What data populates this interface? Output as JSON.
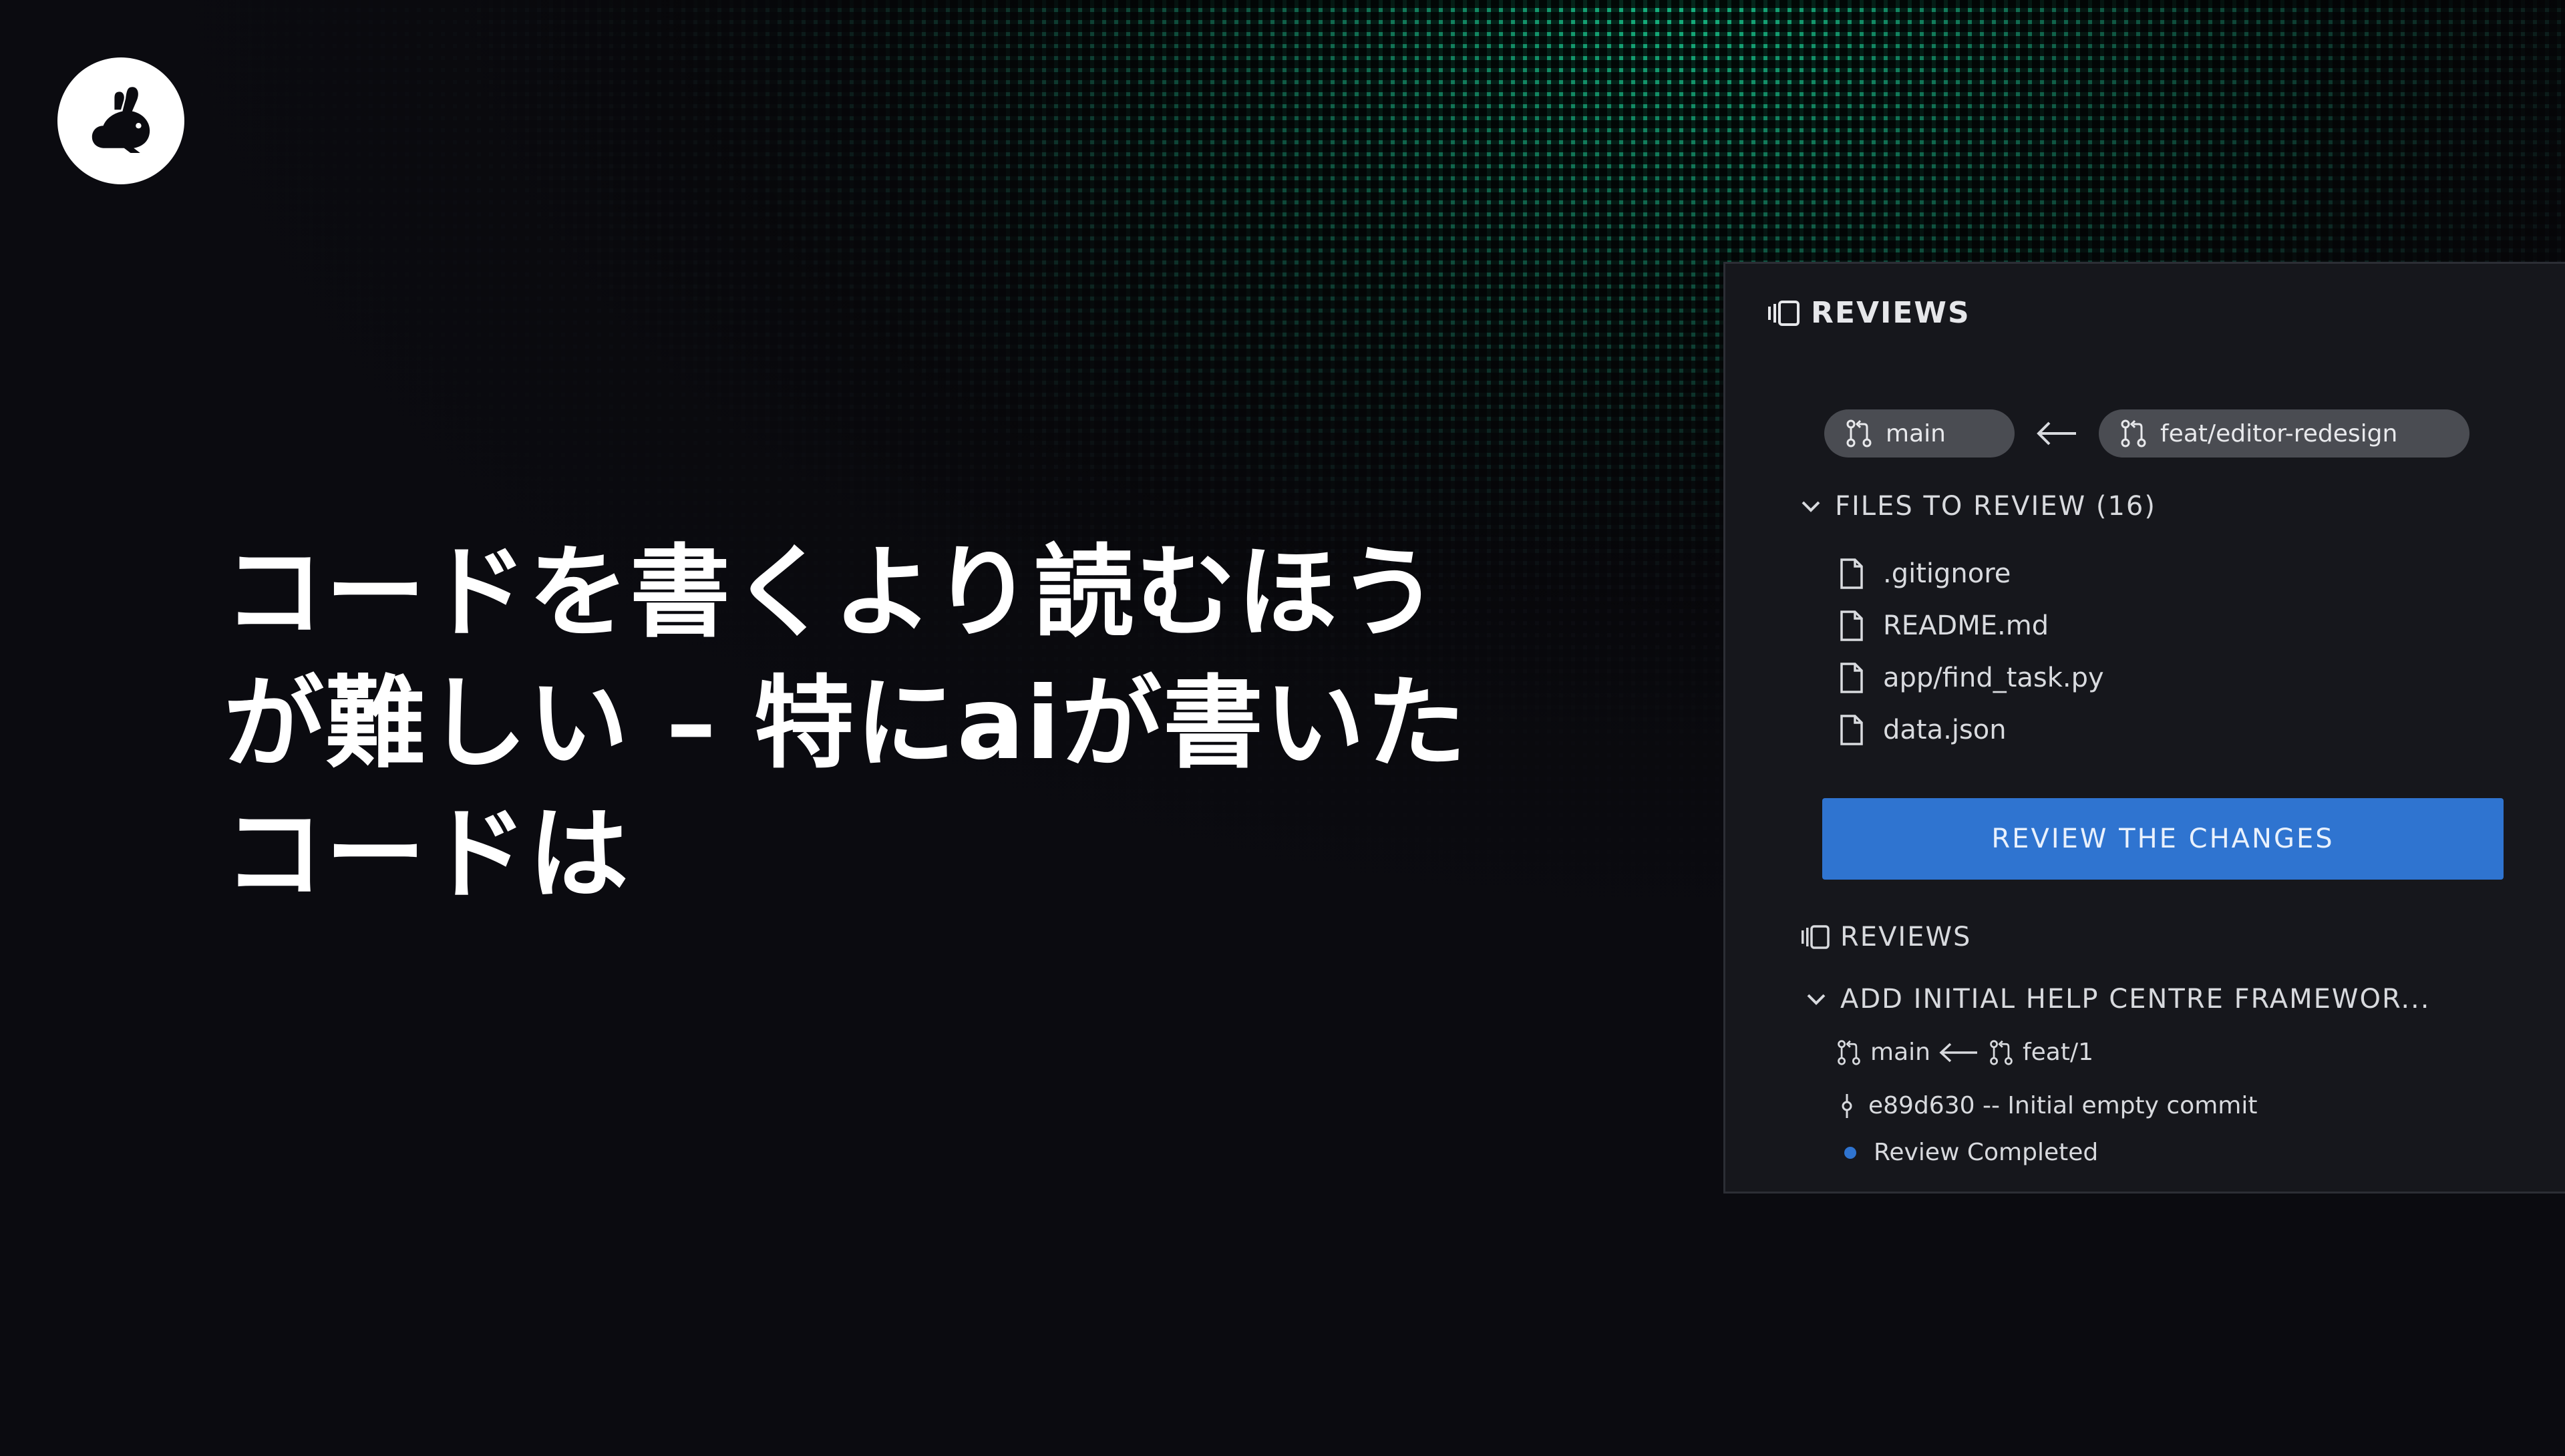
{
  "headline": {
    "line1": "コードを書くより読むほう",
    "line2": "が難しい – 特にaiが書いた",
    "line3": "コードは"
  },
  "logo": {
    "icon": "rabbit-icon"
  },
  "panel": {
    "title": "REVIEWS",
    "base_branch": "main",
    "compare_branch": "feat/editor-redesign",
    "files_section": "FILES TO REVIEW (16)",
    "files": [
      ".gitignore",
      "README.md",
      "app/find_task.py",
      "data.json"
    ],
    "review_button": "REVIEW THE CHANGES",
    "reviews_subtitle": "REVIEWS",
    "review_item": {
      "title": "ADD INITIAL HELP CENTRE FRAMEWOR...",
      "base": "main",
      "head": "feat/1",
      "commit": "e89d630 -- Initial empty commit",
      "status": "Review Completed"
    }
  },
  "colors": {
    "accent_blue": "#2f74d0",
    "glow_green": "#16c48a",
    "panel_bg": "#16171c"
  }
}
